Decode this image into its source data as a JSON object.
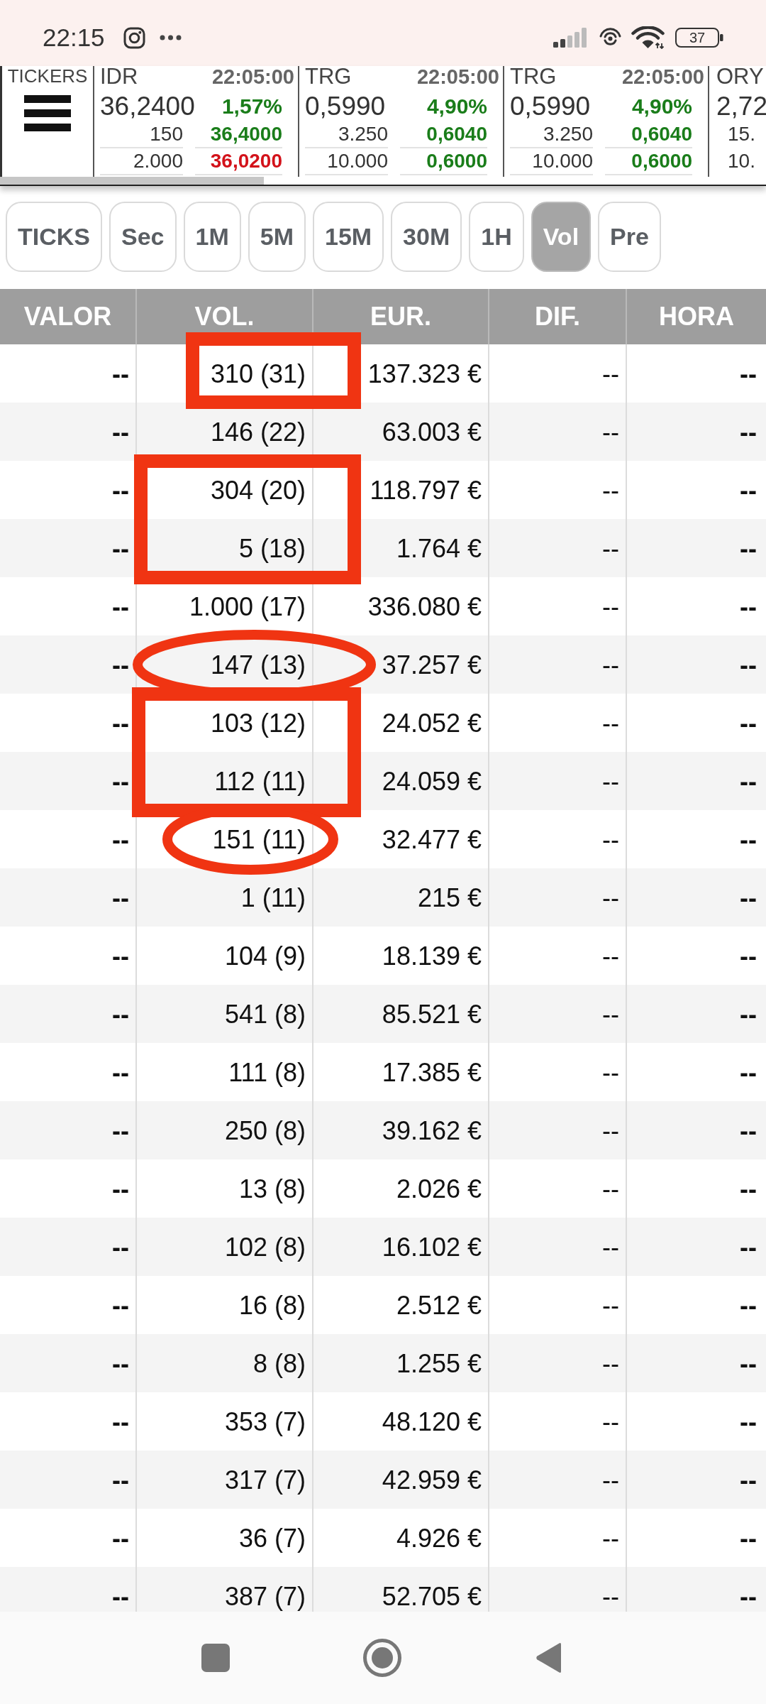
{
  "status_bar": {
    "time": "22:15",
    "battery": "37"
  },
  "ticker_strip": {
    "label": "TICKERS",
    "tickers": [
      {
        "kind": "full",
        "symbol": "IDR",
        "time": "22:05:00",
        "price": "36,2400",
        "change": {
          "text": "1,57%",
          "color": "#1a7d1a"
        },
        "quotes": [
          {
            "size": "150",
            "price": "36,4000",
            "color": "#1a7d1a"
          },
          {
            "size": "2.000",
            "price": "36,0200",
            "color": "#d3121a"
          }
        ]
      },
      {
        "kind": "full",
        "symbol": "TRG",
        "time": "22:05:00",
        "price": "0,5990",
        "change": {
          "text": "4,90%",
          "color": "#1a7d1a"
        },
        "quotes": [
          {
            "size": "3.250",
            "price": "0,6040",
            "color": "#1a7d1a"
          },
          {
            "size": "10.000",
            "price": "0,6000",
            "color": "#1a7d1a"
          }
        ]
      },
      {
        "kind": "full",
        "symbol": "TRG",
        "time": "22:05:00",
        "price": "0,5990",
        "change": {
          "text": "4,90%",
          "color": "#1a7d1a"
        },
        "quotes": [
          {
            "size": "3.250",
            "price": "0,6040",
            "color": "#1a7d1a"
          },
          {
            "size": "10.000",
            "price": "0,6000",
            "color": "#1a7d1a"
          }
        ]
      },
      {
        "kind": "cut",
        "symbol": "ORY",
        "price": "2,72",
        "quotes": [
          {
            "size": "15."
          },
          {
            "size": "10."
          }
        ]
      }
    ]
  },
  "intervals": [
    {
      "label": "TICKS",
      "selected": false
    },
    {
      "label": "Sec",
      "selected": false
    },
    {
      "label": "1M",
      "selected": false
    },
    {
      "label": "5M",
      "selected": false
    },
    {
      "label": "15M",
      "selected": false
    },
    {
      "label": "30M",
      "selected": false
    },
    {
      "label": "1H",
      "selected": false
    },
    {
      "label": "Vol",
      "selected": true
    },
    {
      "label": "Pre",
      "selected": false
    }
  ],
  "table": {
    "columns": [
      "VALOR",
      "VOL.",
      "EUR.",
      "DIF.",
      "HORA"
    ],
    "rows": [
      [
        "--",
        "310 (31)",
        "137.323 €",
        "--",
        "--"
      ],
      [
        "--",
        "146 (22)",
        "63.003 €",
        "--",
        "--"
      ],
      [
        "--",
        "304 (20)",
        "118.797 €",
        "--",
        "--"
      ],
      [
        "--",
        "5 (18)",
        "1.764 €",
        "--",
        "--"
      ],
      [
        "--",
        "1.000 (17)",
        "336.080 €",
        "--",
        "--"
      ],
      [
        "--",
        "147 (13)",
        "37.257 €",
        "--",
        "--"
      ],
      [
        "--",
        "103 (12)",
        "24.052 €",
        "--",
        "--"
      ],
      [
        "--",
        "112 (11)",
        "24.059 €",
        "--",
        "--"
      ],
      [
        "--",
        "151 (11)",
        "32.477 €",
        "--",
        "--"
      ],
      [
        "--",
        "1 (11)",
        "215 €",
        "--",
        "--"
      ],
      [
        "--",
        "104 (9)",
        "18.139 €",
        "--",
        "--"
      ],
      [
        "--",
        "541 (8)",
        "85.521 €",
        "--",
        "--"
      ],
      [
        "--",
        "111 (8)",
        "17.385 €",
        "--",
        "--"
      ],
      [
        "--",
        "250 (8)",
        "39.162 €",
        "--",
        "--"
      ],
      [
        "--",
        "13 (8)",
        "2.026 €",
        "--",
        "--"
      ],
      [
        "--",
        "102 (8)",
        "16.102 €",
        "--",
        "--"
      ],
      [
        "--",
        "16 (8)",
        "2.512 €",
        "--",
        "--"
      ],
      [
        "--",
        "8 (8)",
        "1.255 €",
        "--",
        "--"
      ],
      [
        "--",
        "353 (7)",
        "48.120 €",
        "--",
        "--"
      ],
      [
        "--",
        "317 (7)",
        "42.959 €",
        "--",
        "--"
      ],
      [
        "--",
        "36 (7)",
        "4.926 €",
        "--",
        "--"
      ],
      [
        "--",
        "387 (7)",
        "52.705 €",
        "--",
        "--"
      ]
    ]
  },
  "annotations": [
    {
      "kind": "rectangle"
    },
    {
      "kind": "rectangle"
    },
    {
      "kind": "ellipse"
    },
    {
      "kind": "rectangle"
    },
    {
      "kind": "ellipse"
    }
  ]
}
